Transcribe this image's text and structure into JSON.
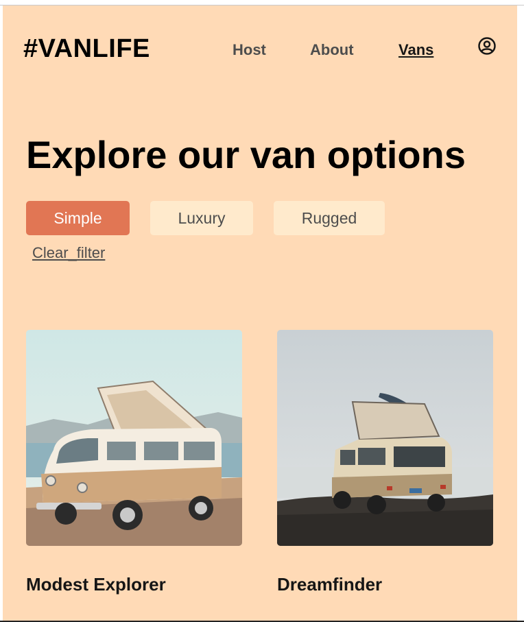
{
  "header": {
    "logo": "#VANLIFE",
    "nav": [
      {
        "label": "Host"
      },
      {
        "label": "About"
      },
      {
        "label": "Vans",
        "active": true
      }
    ],
    "account_icon": "user-circle-icon"
  },
  "main": {
    "title": "Explore our van options",
    "filters": [
      {
        "label": "Simple",
        "active": true
      },
      {
        "label": "Luxury",
        "active": false
      },
      {
        "label": "Rugged",
        "active": false
      }
    ],
    "clear_filter": "Clear_filter",
    "vans": [
      {
        "name": "Modest Explorer"
      },
      {
        "name": "Dreamfinder"
      }
    ]
  },
  "colors": {
    "page_bg": "#ffdab6",
    "accent": "#e17654",
    "filter_bg": "#ffeacc"
  }
}
